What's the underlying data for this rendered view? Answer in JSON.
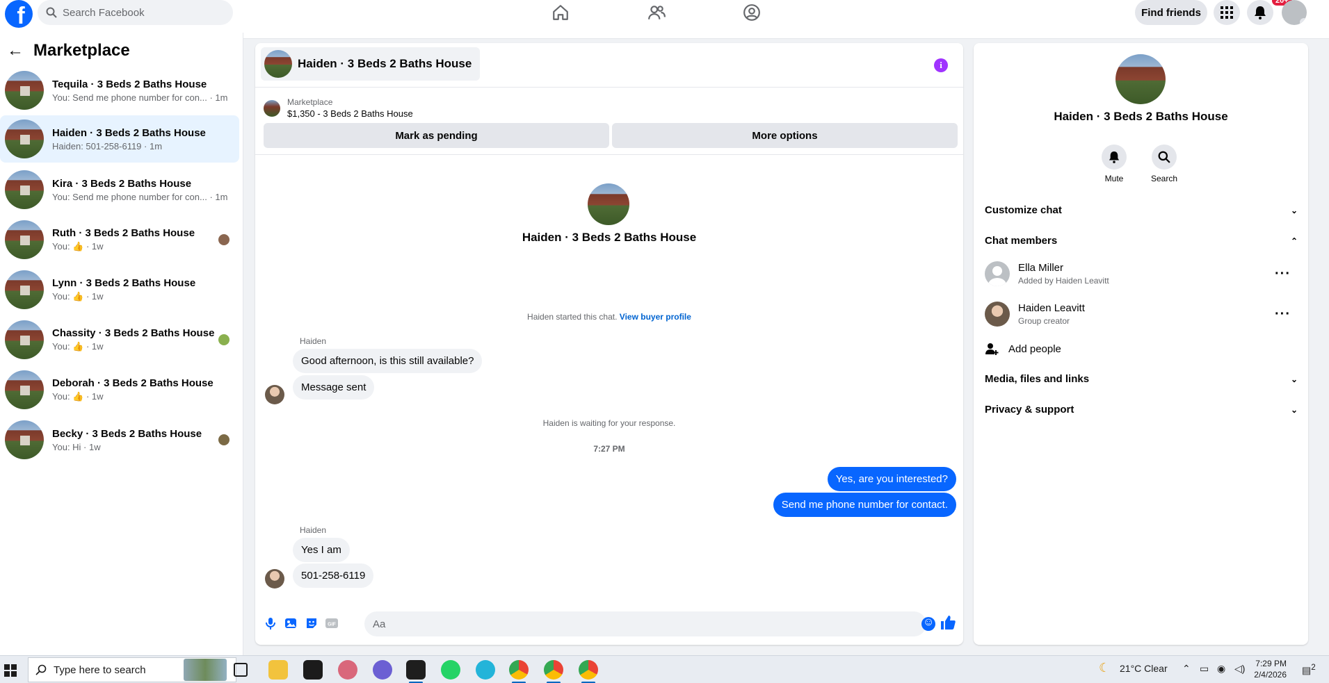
{
  "topbar": {
    "search_placeholder": "Search Facebook",
    "find_friends": "Find friends",
    "notif_badge": "20+"
  },
  "sidebar": {
    "title": "Marketplace",
    "conversations": [
      {
        "name": "Tequila · 3 Beds 2 Baths House",
        "preview": "You: Send me phone number for con... · 1m",
        "active": false
      },
      {
        "name": "Haiden · 3 Beds 2 Baths House",
        "preview": "Haiden: 501-258-6119 · 1m",
        "active": true
      },
      {
        "name": "Kira · 3 Beds 2 Baths House",
        "preview": "You: Send me phone number for con... · 1m",
        "active": false
      },
      {
        "name": "Ruth · 3 Beds 2 Baths House",
        "preview": "You: 👍 · 1w",
        "active": false
      },
      {
        "name": "Lynn · 3 Beds 2 Baths House",
        "preview": "You: 👍 · 1w",
        "active": false
      },
      {
        "name": "Chassity · 3 Beds 2 Baths House",
        "preview": "You: 👍 · 1w",
        "active": false
      },
      {
        "name": "Deborah · 3 Beds 2 Baths House",
        "preview": "You: 👍 · 1w",
        "active": false
      },
      {
        "name": "Becky · 3 Beds 2 Baths House",
        "preview": "You: Hi · 1w",
        "active": false
      }
    ]
  },
  "chat": {
    "title": "Haiden · 3 Beds 2 Baths House",
    "listing_label": "Marketplace",
    "listing_price": "$1,350 - 3 Beds 2 Baths House",
    "mark_pending": "Mark as pending",
    "more_options": "More options",
    "center_name": "Haiden · 3 Beds 2 Baths House",
    "started_text": "Haiden started this chat.",
    "view_profile": "View buyer profile",
    "sender1": "Haiden",
    "msg1": "Good afternoon, is this still available?",
    "msg2": "Message sent",
    "waiting_text": "Haiden is waiting for your response.",
    "timestamp": "7:27 PM",
    "out1": "Yes, are you interested?",
    "out2": "Send me phone number for contact.",
    "sender2": "Haiden",
    "msg3": "Yes I am",
    "msg4": "501-258-6119",
    "input_placeholder": "Aa"
  },
  "rpanel": {
    "name": "Haiden · 3 Beds 2 Baths House",
    "mute": "Mute",
    "search": "Search",
    "customize": "Customize chat",
    "members_header": "Chat members",
    "members": [
      {
        "name": "Ella Miller",
        "sub": "Added by Haiden Leavitt"
      },
      {
        "name": "Haiden Leavitt",
        "sub": "Group creator"
      }
    ],
    "add_people": "Add people",
    "media": "Media, files and links",
    "privacy": "Privacy & support"
  },
  "taskbar": {
    "search_placeholder": "Type here to search",
    "weather": "21°C  Clear",
    "time": "7:29 PM",
    "date": "2/4/2026",
    "notif_count": "2"
  },
  "colors": {
    "brand": "#0866ff",
    "active_bg": "#e7f3ff",
    "info": "#a033ff"
  }
}
